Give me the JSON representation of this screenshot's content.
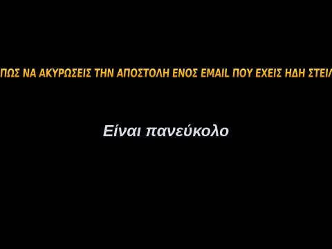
{
  "slide": {
    "heading": "ΠΩΣ ΝΑ ΑΚΥΡΩΣΕΙΣ ΤΗΝ ΑΠΟΣΤΟΛΗ ΕΝΟΣ EMAIL ΠΟΥ ΕΧΕΙΣ ΗΔΗ ΣΤΕΙΛΕΙ",
    "subheading": "Είναι πανεύκολο"
  },
  "colors": {
    "background": "#000000",
    "heading_gold": "#f6b91e",
    "subheading": "#d6dce4"
  }
}
